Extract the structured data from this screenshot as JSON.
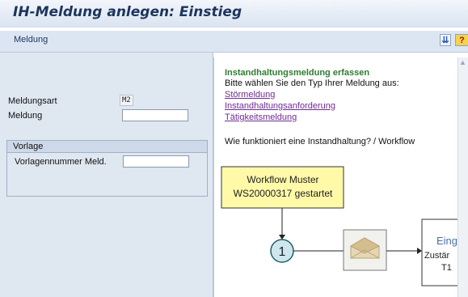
{
  "window": {
    "title": "IH-Meldung anlegen: Einstieg"
  },
  "menubar": {
    "menu": "Meldung",
    "sort_icon_glyph": "⇊",
    "help_icon_glyph": "?"
  },
  "form": {
    "meldungsart_label": "Meldungsart",
    "meldungsart_value": "M2",
    "meldung_label": "Meldung",
    "meldung_value": "",
    "vorlage": {
      "title": "Vorlage",
      "vorlagennummer_label": "Vorlagennummer Meld.",
      "vorlagennummer_value": ""
    }
  },
  "help": {
    "title": "Instandhaltungsmeldung erfassen",
    "instruction": "Bitte wählen Sie den Typ Ihrer Meldung aus:",
    "links": [
      "Störmeldung",
      "Instandhaltungsanforderung",
      "Tätigkeitsmeldung"
    ],
    "question": "Wie funktioniert eine Instandhaltung? / Workflow"
  },
  "workflow": {
    "start_box_line1": "Workflow Muster",
    "start_box_line2": "WS20000317 gestartet",
    "step_number": "1",
    "next_box_line1": "Eing",
    "next_box_line2": "Zustär",
    "next_box_line3": "T1"
  },
  "colors": {
    "help_title": "#2e7d32",
    "link": "#6f2c91",
    "workflow_box_fill": "#fff9a8",
    "workflow_circle_fill": "#cfe7ec"
  }
}
